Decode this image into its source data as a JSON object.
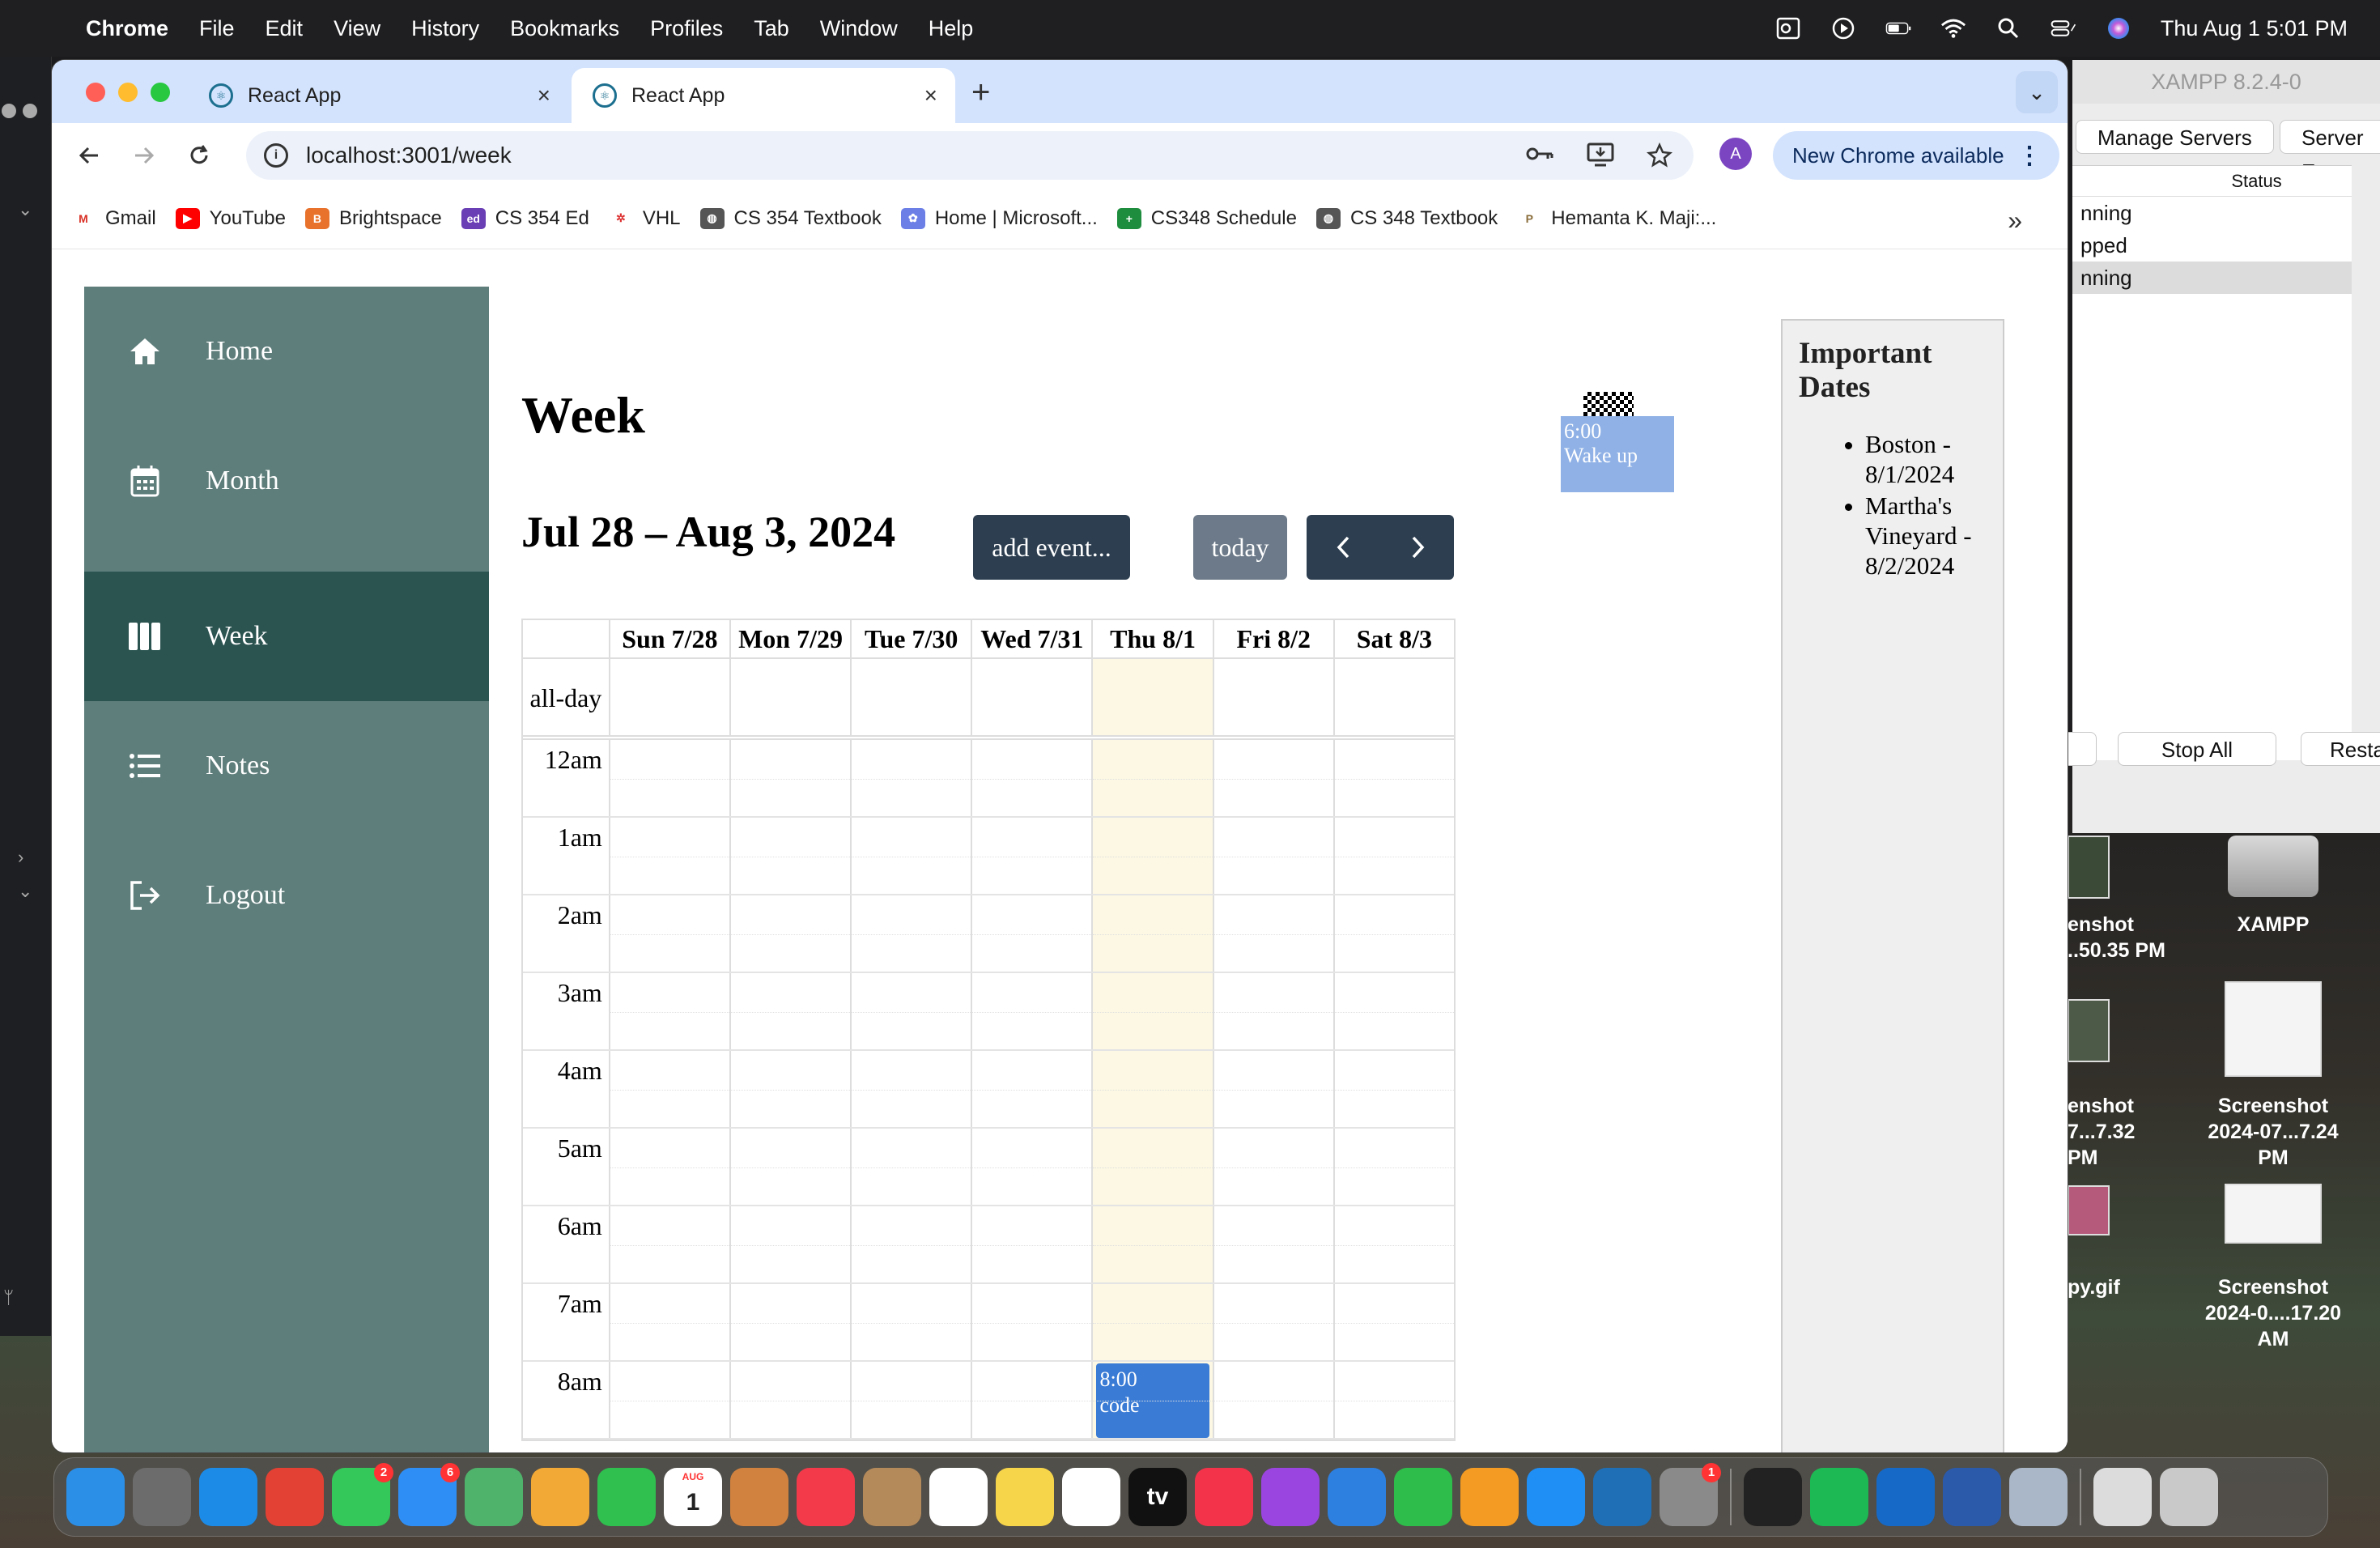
{
  "menubar": {
    "items": [
      "Chrome",
      "File",
      "Edit",
      "View",
      "History",
      "Bookmarks",
      "Profiles",
      "Tab",
      "Window",
      "Help"
    ],
    "clock": "Thu Aug 1  5:01 PM"
  },
  "xampp": {
    "title": "XAMPP 8.2.4-0",
    "tab_manage": "Manage Servers",
    "tab_events": "Server Ev",
    "status_header": "Status",
    "rows": [
      "nning",
      "pped",
      "nning"
    ],
    "stop_all": "Stop All",
    "restart": "Resta"
  },
  "desktop": {
    "icons": [
      {
        "label1": "enshot",
        "label2": "..50.35 PM"
      },
      {
        "label1": "XAMPP",
        "label2": ""
      },
      {
        "label1": "enshot",
        "label2": "7...7.32 PM"
      },
      {
        "label1": "Screenshot",
        "label2": "2024-07...7.24 PM"
      },
      {
        "label1": "py.gif",
        "label2": ""
      },
      {
        "label1": "Screenshot",
        "label2": "2024-0....17.20 AM"
      }
    ]
  },
  "browser": {
    "tabs": [
      {
        "title": "React App"
      },
      {
        "title": "React App"
      }
    ],
    "url": "localhost:3001/week",
    "avatar": "A",
    "update_label": "New Chrome available",
    "bookmarks": [
      {
        "label": "Gmail",
        "color": "#ffffff",
        "glyph": "M",
        "fg": "#d93025"
      },
      {
        "label": "YouTube",
        "color": "#ff0000",
        "glyph": "▶",
        "fg": "#ffffff"
      },
      {
        "label": "Brightspace",
        "color": "#e8722c",
        "glyph": "B",
        "fg": "#ffffff"
      },
      {
        "label": "CS 354 Ed",
        "color": "#6a3fb5",
        "glyph": "ed",
        "fg": "#ffffff"
      },
      {
        "label": "VHL",
        "color": "#ffffff",
        "glyph": "✲",
        "fg": "#d33"
      },
      {
        "label": "CS 354 Textbook",
        "color": "#555555",
        "glyph": "◍",
        "fg": "#ffffff"
      },
      {
        "label": "Home | Microsoft...",
        "color": "#6b7fe6",
        "glyph": "✿",
        "fg": "#ffffff"
      },
      {
        "label": "CS348 Schedule",
        "color": "#1e8e3e",
        "glyph": "+",
        "fg": "#ffffff"
      },
      {
        "label": "CS 348 Textbook",
        "color": "#555555",
        "glyph": "◍",
        "fg": "#ffffff"
      },
      {
        "label": "Hemanta K. Maji:...",
        "color": "#ffffff",
        "glyph": "P",
        "fg": "#8a6d3b"
      }
    ]
  },
  "app": {
    "nav": [
      {
        "label": "Home",
        "icon": "home-icon"
      },
      {
        "label": "Month",
        "icon": "calendar-icon"
      },
      {
        "label": "Week",
        "icon": "week-columns-icon"
      },
      {
        "label": "Notes",
        "icon": "list-icon"
      },
      {
        "label": "Logout",
        "icon": "logout-icon"
      }
    ],
    "title": "Week",
    "range": "Jul 28 – Aug 3, 2024",
    "add_event": "add event...",
    "today": "today",
    "days": [
      "Sun 7/28",
      "Mon 7/29",
      "Tue 7/30",
      "Wed 7/31",
      "Thu 8/1",
      "Fri 8/2",
      "Sat 8/3"
    ],
    "today_index": 4,
    "allday_label": "all-day",
    "hours": [
      "12am",
      "1am",
      "2am",
      "3am",
      "4am",
      "5am",
      "6am",
      "7am",
      "8am"
    ],
    "event": {
      "time": "8:00",
      "title": "code",
      "day": "Thu 8/1"
    },
    "dragged_event": {
      "time": "6:00",
      "title": "Wake up"
    },
    "important": {
      "title": "Important Dates",
      "items": [
        "Boston - 8/1/2024",
        "Martha's Vineyard - 8/2/2024"
      ]
    }
  },
  "dock": {
    "apps": [
      {
        "name": "finder",
        "color": "#2b8fe8"
      },
      {
        "name": "launchpad",
        "color": "#6c6c6c"
      },
      {
        "name": "safari",
        "color": "#1c8be8"
      },
      {
        "name": "chrome",
        "color": "#e34133"
      },
      {
        "name": "messages",
        "color": "#34c759",
        "badge": "2"
      },
      {
        "name": "mail",
        "color": "#2f8ef5",
        "badge": "6"
      },
      {
        "name": "maps",
        "color": "#4fb36b"
      },
      {
        "name": "photos",
        "color": "#f3a935"
      },
      {
        "name": "facetime",
        "color": "#2fc04f"
      },
      {
        "name": "calendar",
        "color": "#ffffff",
        "text": "1",
        "sub": "AUG"
      },
      {
        "name": "keynote-box",
        "color": "#d1823f"
      },
      {
        "name": "news",
        "color": "#f23a4a"
      },
      {
        "name": "contacts",
        "color": "#b48a5a"
      },
      {
        "name": "reminders",
        "color": "#ffffff"
      },
      {
        "name": "notes",
        "color": "#f7d54a"
      },
      {
        "name": "freeform",
        "color": "#ffffff"
      },
      {
        "name": "appletv",
        "color": "#111111",
        "text": "tv"
      },
      {
        "name": "music",
        "color": "#f3334a"
      },
      {
        "name": "podcasts",
        "color": "#9a45e0"
      },
      {
        "name": "keynote",
        "color": "#2d7fe0"
      },
      {
        "name": "numbers",
        "color": "#2ebd4a"
      },
      {
        "name": "pages",
        "color": "#f39b22"
      },
      {
        "name": "appstore",
        "color": "#1f8ef5"
      },
      {
        "name": "vscode",
        "color": "#1e6fb5"
      },
      {
        "name": "system-settings",
        "color": "#8a8a8a",
        "badge": "1"
      },
      {
        "name": "terminal",
        "color": "#222222"
      },
      {
        "name": "spotify",
        "color": "#1db954"
      },
      {
        "name": "outlook",
        "color": "#1669c6"
      },
      {
        "name": "word",
        "color": "#2b5aab"
      },
      {
        "name": "settings-gear",
        "color": "#aab7c8"
      },
      {
        "name": "downloads-stack",
        "color": "#dcdcdc"
      },
      {
        "name": "trash",
        "color": "#c9c9c9"
      }
    ]
  }
}
